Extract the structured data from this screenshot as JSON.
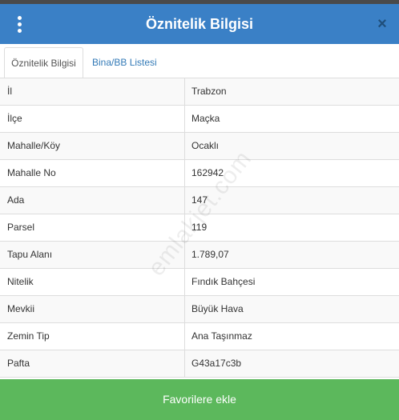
{
  "header": {
    "title": "Öznitelik Bilgisi",
    "close_glyph": "×",
    "menu_icon": "vertical-dots-icon",
    "close_icon": "close-icon",
    "background": "#3a80c6"
  },
  "tabs": [
    {
      "label": "Öznitelik Bilgisi",
      "active": true
    },
    {
      "label": "Bina/BB Listesi",
      "active": false
    }
  ],
  "attributes": [
    {
      "key": "İl",
      "value": "Trabzon"
    },
    {
      "key": "İlçe",
      "value": "Maçka"
    },
    {
      "key": "Mahalle/Köy",
      "value": "Ocaklı"
    },
    {
      "key": "Mahalle No",
      "value": "162942"
    },
    {
      "key": "Ada",
      "value": "147"
    },
    {
      "key": "Parsel",
      "value": "119"
    },
    {
      "key": "Tapu Alanı",
      "value": "1.789,07"
    },
    {
      "key": "Nitelik",
      "value": "Fındık Bahçesi"
    },
    {
      "key": "Mevkii",
      "value": "Büyük Hava"
    },
    {
      "key": "Zemin Tip",
      "value": "Ana Taşınmaz"
    },
    {
      "key": "Pafta",
      "value": "G43a17c3b"
    }
  ],
  "watermark": "emlakjet.com",
  "footer": {
    "favorite_label": "Favorilere ekle",
    "background": "#5cb85c"
  }
}
